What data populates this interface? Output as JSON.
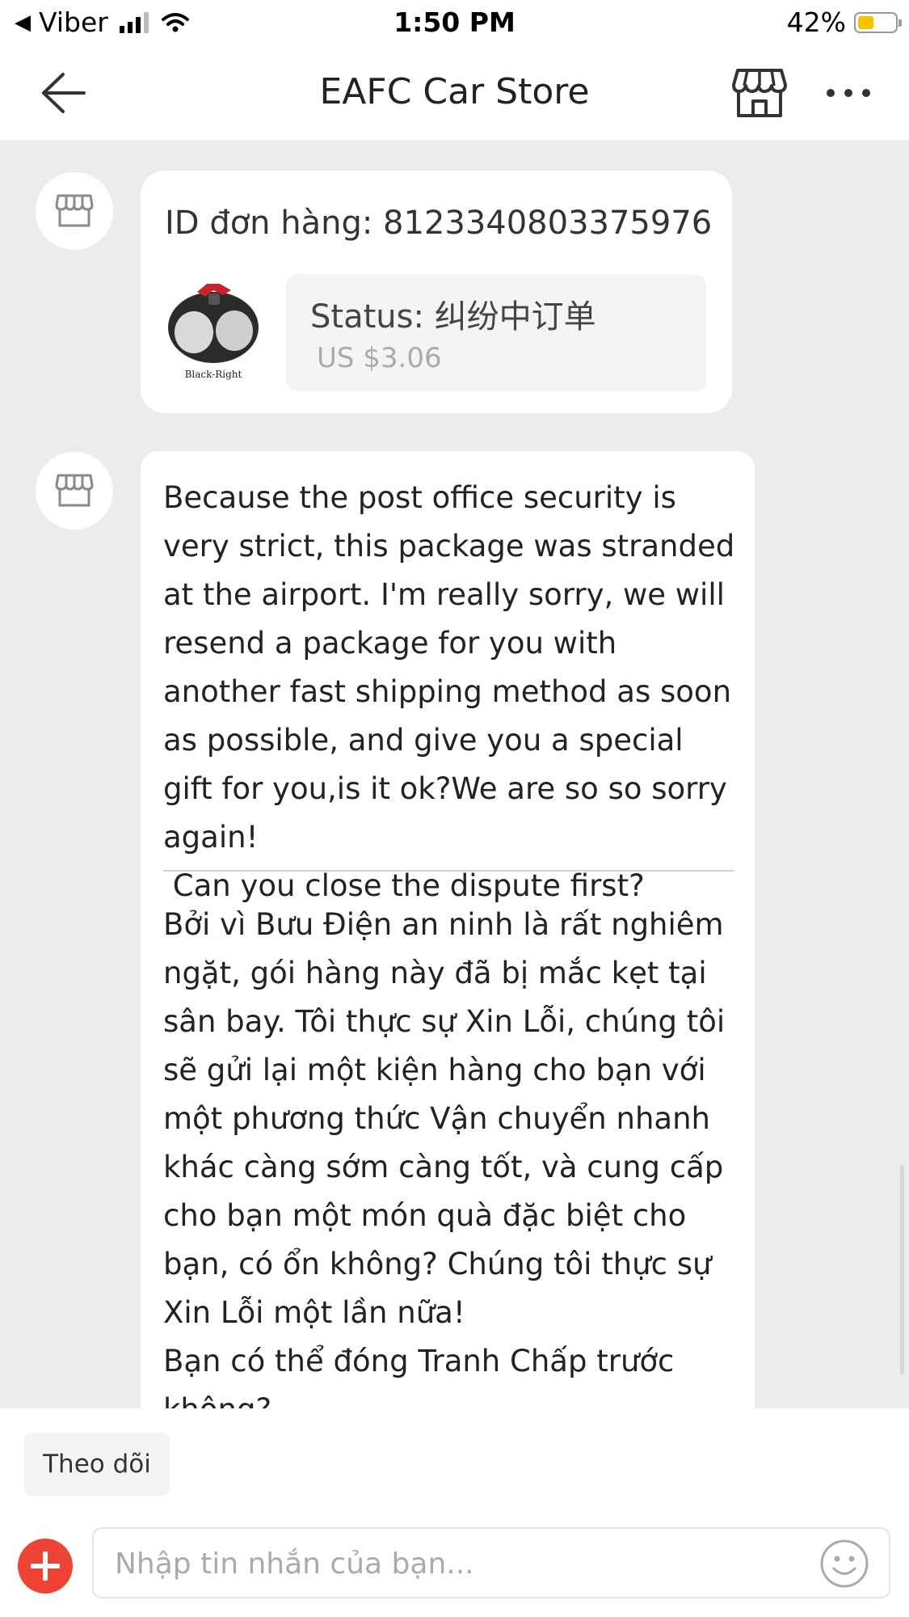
{
  "status_bar": {
    "back_app": "Viber",
    "time": "1:50 PM",
    "battery": "42%",
    "battery_level": 0.42
  },
  "header": {
    "title": "EAFC Car Store"
  },
  "order_card": {
    "order_id": "ID đơn hàng: 8123340803375976",
    "product_caption": "Black-Right",
    "status": "Status:  纠纷中订单",
    "price": "US $3.06"
  },
  "message": {
    "text_en": "Because the post office security is very strict, this package was stranded at the airport. I'm really sorry, we will resend a package for you with another fast shipping method as soon as possible, and give you a special gift for you,is it ok?We are so so sorry again!\n Can you close the dispute first?",
    "text_vi": "Bởi vì Bưu Điện an ninh là rất nghiêm ngặt, gói hàng này đã bị mắc kẹt tại sân bay. Tôi thực sự Xin Lỗi, chúng tôi sẽ gửi lại một kiện hàng cho bạn với một phương thức Vận chuyển nhanh khác càng sớm càng tốt, và cung cấp cho bạn một món quà đặc biệt cho bạn, có ổn không? Chúng tôi thực sự Xin Lỗi một lần nữa!\nBạn có thể đóng Tranh Chấp trước không?"
  },
  "bottom": {
    "follow_label": "Theo dõi",
    "input_placeholder": "Nhập tin nhắn của bạn...",
    "input_value": ""
  },
  "icons": {
    "back": "arrow-left-icon",
    "store": "store-icon",
    "more": "more-horizontal-icon",
    "avatar": "shop-awning-icon",
    "plus": "plus-icon",
    "emoji": "smiley-icon"
  },
  "colors": {
    "accent": "#ef4335",
    "battery": "#f5c400",
    "chat_background": "#ececec"
  }
}
